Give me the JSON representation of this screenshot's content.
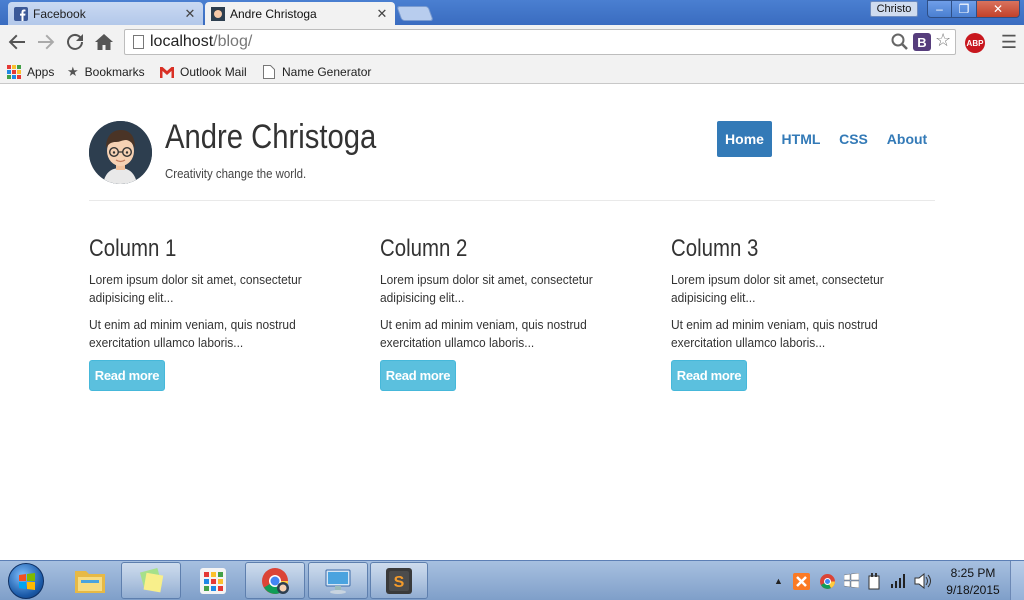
{
  "browser": {
    "tabs": [
      {
        "label": "Facebook",
        "icon": "facebook-icon",
        "active": false
      },
      {
        "label": "Andre Christoga",
        "icon": "avatar-favicon-icon",
        "active": true
      }
    ],
    "user_chip": "Christo",
    "window_buttons": {
      "minimize": "–",
      "restore": "❐",
      "close": "✕"
    },
    "url_host": "localhost",
    "url_path": "/blog/",
    "bookmarks": [
      {
        "label": "Apps",
        "icon": "apps-grid-icon"
      },
      {
        "label": "Bookmarks",
        "icon": "star-icon"
      },
      {
        "label": "Outlook Mail",
        "icon": "gmail-icon"
      },
      {
        "label": "Name Generator",
        "icon": "page-icon"
      }
    ],
    "extension_abp": "ABP",
    "extension_b": "B"
  },
  "site": {
    "title": "Andre Christoga",
    "tagline": "Creativity change the world.",
    "nav": [
      {
        "label": "Home",
        "active": true
      },
      {
        "label": "HTML",
        "active": false
      },
      {
        "label": "CSS",
        "active": false
      },
      {
        "label": "About",
        "active": false
      }
    ],
    "columns": [
      {
        "heading": "Column 1",
        "p1": "Lorem ipsum dolor sit amet, consectetur adipisicing elit...",
        "p2": "Ut enim ad minim veniam, quis nostrud exercitation ullamco laboris...",
        "button": "Read more"
      },
      {
        "heading": "Column 2",
        "p1": "Lorem ipsum dolor sit amet, consectetur adipisicing elit...",
        "p2": "Ut enim ad minim veniam, quis nostrud exercitation ullamco laboris...",
        "button": "Read more"
      },
      {
        "heading": "Column 3",
        "p1": "Lorem ipsum dolor sit amet, consectetur adipisicing elit...",
        "p2": "Ut enim ad minim veniam, quis nostrud exercitation ullamco laboris...",
        "button": "Read more"
      }
    ],
    "colors": {
      "primary": "#337ab7",
      "info": "#5bc0de"
    }
  },
  "taskbar": {
    "time": "8:25 PM",
    "date": "9/18/2015",
    "pinned": [
      "explorer-icon",
      "sticky-notes-icon",
      "apps-launcher-icon",
      "chrome-icon",
      "remote-desktop-icon",
      "sublime-text-icon"
    ],
    "tray": [
      "show-hidden-icons-icon",
      "xampp-icon",
      "chrome-tray-icon",
      "windows-flag-icon",
      "power-icon",
      "signal-icon",
      "volume-icon"
    ]
  }
}
